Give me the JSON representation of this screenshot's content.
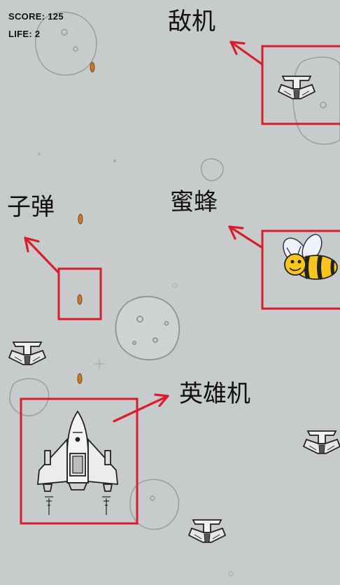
{
  "hud": {
    "score_label": "SCORE: 125",
    "life_label": "LIFE: 2"
  },
  "annotations": {
    "enemy": "敌机",
    "bee": "蜜蜂",
    "bullet": "子弹",
    "hero": "英雄机"
  },
  "colors": {
    "background": "#c8cbcc",
    "annotation_red": "#d81e2c",
    "ink": "#2a2a2a",
    "bee_yellow": "#f7c51e",
    "bullet_orange": "#c77a2a"
  },
  "icons": [
    "enemy-plane-icon",
    "bee-icon",
    "bullet-icon",
    "hero-plane-icon",
    "asteroid-icon"
  ]
}
